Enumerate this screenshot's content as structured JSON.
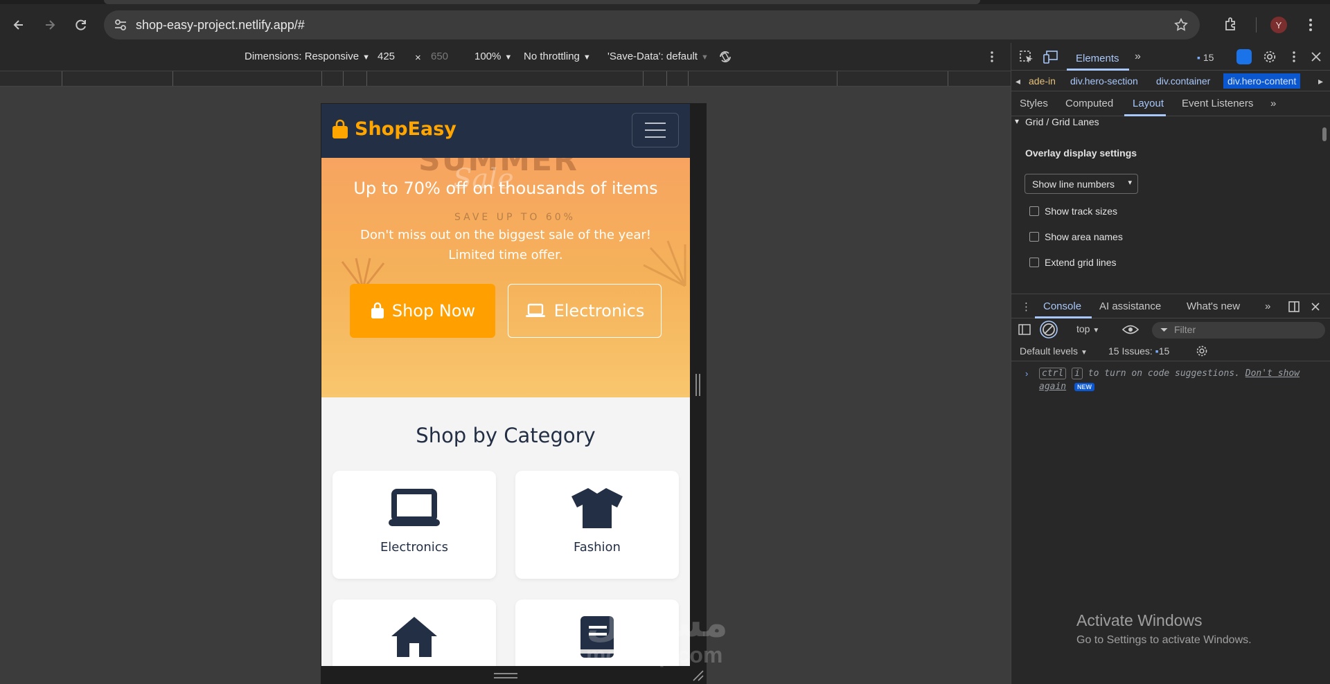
{
  "browser": {
    "url": "shop-easy-project.netlify.app/#",
    "avatar_letter": "Y"
  },
  "device_toolbar": {
    "dimensions_label": "Dimensions: Responsive",
    "width": "425",
    "times": "×",
    "height": "650",
    "zoom": "100%",
    "throttling": "No throttling",
    "save_data": "'Save-Data': default"
  },
  "site": {
    "brand": "ShopEasy",
    "hero_bg_text": "SUMMER",
    "hero_bg_script": "Sale",
    "hero_save_text": "SAVE UP TO 60%",
    "hero_heading": "Up to 70% off on thousands of items",
    "hero_text": "Don't miss out on the biggest sale of the year! Limited time offer.",
    "btn_shop_now": "Shop Now",
    "btn_electronics": "Electronics",
    "section_title": "Shop by Category",
    "categories": [
      {
        "label": "Electronics",
        "icon": "laptop-icon"
      },
      {
        "label": "Fashion",
        "icon": "tshirt-icon"
      },
      {
        "label": "",
        "icon": "home-icon"
      },
      {
        "label": "",
        "icon": "book-icon"
      }
    ]
  },
  "watermark": {
    "arabic": "مستقل",
    "latin": "mostaql.com"
  },
  "devtools": {
    "tab_elements": "Elements",
    "issues_count": "15",
    "breadcrumbs": [
      "ade-in",
      "div.hero-section",
      "div.container",
      "div.hero-content"
    ],
    "subtabs": [
      "Styles",
      "Computed",
      "Layout",
      "Event Listeners"
    ],
    "section_heading": "Grid / Grid Lanes",
    "overlay_title": "Overlay display settings",
    "select_value": "Show line numbers",
    "checks": [
      "Show track sizes",
      "Show area names",
      "Extend grid lines"
    ],
    "drawer_tabs": [
      "Console",
      "AI assistance",
      "What's new"
    ],
    "context": "top",
    "filter_placeholder": "Filter",
    "levels": "Default levels",
    "issues_label": "15 Issues:",
    "issues_num": "15",
    "msg_ctrl": "ctrl",
    "msg_i": "i",
    "msg_text": "to turn on code suggestions.",
    "msg_link": "Don't show again",
    "msg_badge": "NEW"
  },
  "windows": {
    "activate_title": "Activate Windows",
    "activate_sub": "Go to Settings to activate Windows."
  },
  "colors": {
    "brand_orange": "#ffa500",
    "nav_dark": "#232f44",
    "devtools_blue": "#a8c7fa"
  }
}
